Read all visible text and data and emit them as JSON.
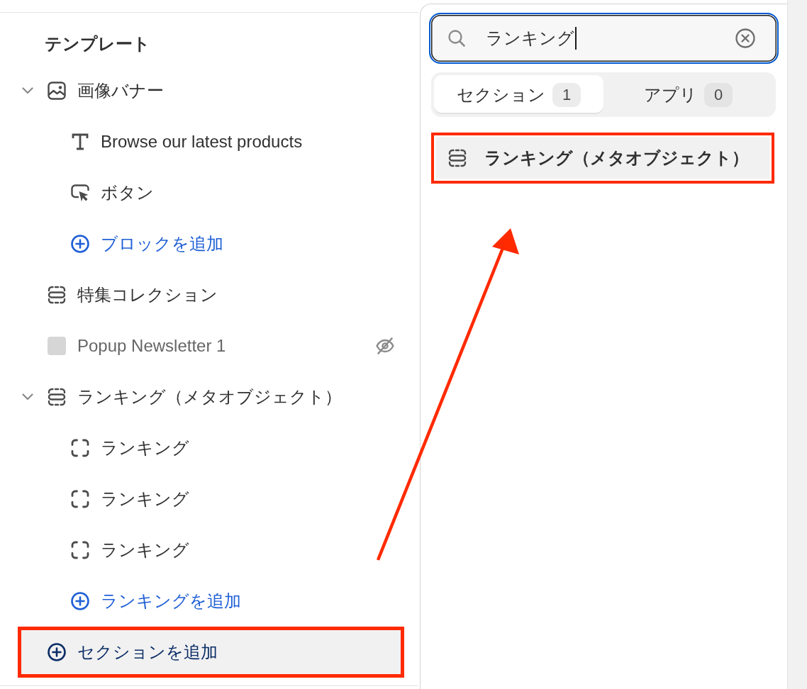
{
  "sidebar": {
    "title": "テンプレート",
    "items": [
      {
        "kind": "image",
        "label": "画像バナー",
        "expanded": true,
        "hidden": false,
        "children": [
          {
            "kind": "text",
            "label": "Browse our latest products"
          },
          {
            "kind": "button",
            "label": "ボタン"
          },
          {
            "kind": "add",
            "label": "ブロックを追加"
          }
        ]
      },
      {
        "kind": "section",
        "label": "特集コレクション",
        "hidden": false
      },
      {
        "kind": "app",
        "label": "Popup Newsletter 1",
        "hidden": true
      },
      {
        "kind": "section",
        "label": "ランキング（メタオブジェクト）",
        "expanded": true,
        "hidden": false,
        "children": [
          {
            "kind": "block",
            "label": "ランキング"
          },
          {
            "kind": "block",
            "label": "ランキング"
          },
          {
            "kind": "block",
            "label": "ランキング"
          },
          {
            "kind": "add",
            "label": "ランキングを追加"
          }
        ]
      }
    ],
    "add_section": {
      "label": "セクションを追加",
      "highlighted": true
    }
  },
  "picker": {
    "search": {
      "value": "ランキング",
      "focused": true
    },
    "tabs": [
      {
        "label": "セクション",
        "count": "1",
        "selected": true
      },
      {
        "label": "アプリ",
        "count": "0",
        "selected": false
      }
    ],
    "results": [
      {
        "kind": "section",
        "label": "ランキング（メタオブジェクト）",
        "highlighted": true
      }
    ]
  },
  "annotations": [
    {
      "kind": "arrow"
    }
  ]
}
